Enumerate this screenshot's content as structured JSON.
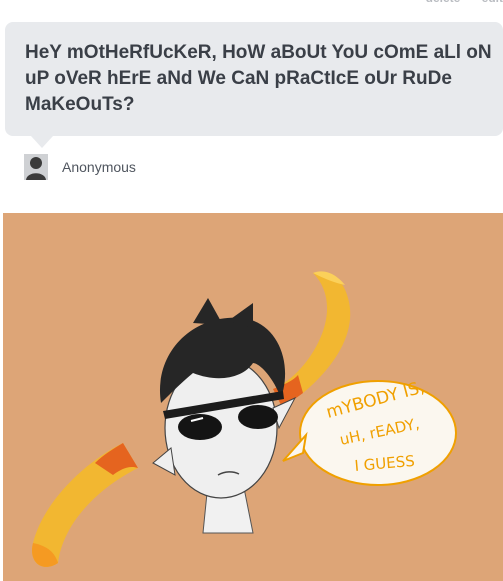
{
  "post": {
    "actions": [
      "delete",
      "edit"
    ],
    "question": "HeY mOtHeRfUcKeR, HoW aBoUt YoU cOmE aLl oN uP oVeR hErE aNd We CaN pRaCtIcE oUr RuDe MaKeOuTs?",
    "asker_name": "Anonymous",
    "avatar_icon": "anonymous-avatar-icon"
  },
  "illustration": {
    "background_color": "#dda577",
    "speech_bubble_text": [
      "mYBODY IS,",
      "uH, rEADY,",
      "I GUESS"
    ]
  }
}
